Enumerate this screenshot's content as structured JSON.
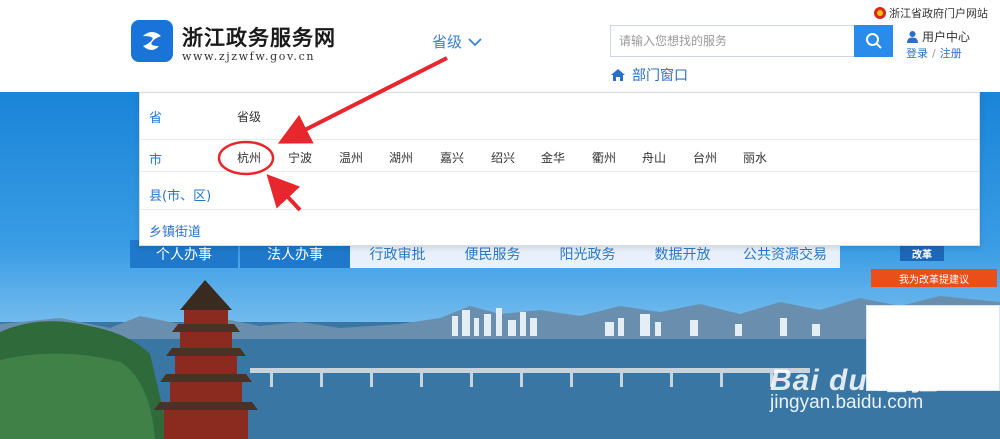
{
  "header": {
    "gov_portal_link": "浙江省政府门户网站",
    "site_title": "浙江政务服务网",
    "site_domain": "www.zjzwfw.gov.cn",
    "province_select": "省级",
    "search_placeholder": "请输入您想找的服务",
    "user_center": "用户中心",
    "login": "登录",
    "separator": "/",
    "register": "注册",
    "dept_window": "部门窗口"
  },
  "dropdown": {
    "rows": [
      {
        "label": "省",
        "items": [
          "省级"
        ]
      },
      {
        "label": "市",
        "items": [
          "杭州",
          "宁波",
          "温州",
          "湖州",
          "嘉兴",
          "绍兴",
          "金华",
          "衢州",
          "舟山",
          "台州",
          "丽水"
        ]
      },
      {
        "label": "县(市、区)",
        "items": []
      },
      {
        "label": "乡镇街道",
        "items": []
      }
    ],
    "highlighted_item": "杭州"
  },
  "nav_tabs": [
    "个人办事",
    "法人办事",
    "行政审批",
    "便民服务",
    "阳光政务",
    "数据开放",
    "公共资源交易"
  ],
  "reform": {
    "tag": "改革",
    "button": "我为改革提建议"
  },
  "watermark": {
    "logo": "Bai du 经验",
    "url": "jingyan.baidu.com"
  },
  "colors": {
    "brand_blue": "#1a73d9",
    "link_blue": "#2a74c9",
    "search_button": "#2a8bea",
    "annotation_red": "#e8262d",
    "reform_orange": "#e94e1b"
  },
  "icons": [
    "gov-emblem-icon",
    "site-logo-icon",
    "chevron-down-icon",
    "search-icon",
    "user-icon",
    "home-icon"
  ]
}
